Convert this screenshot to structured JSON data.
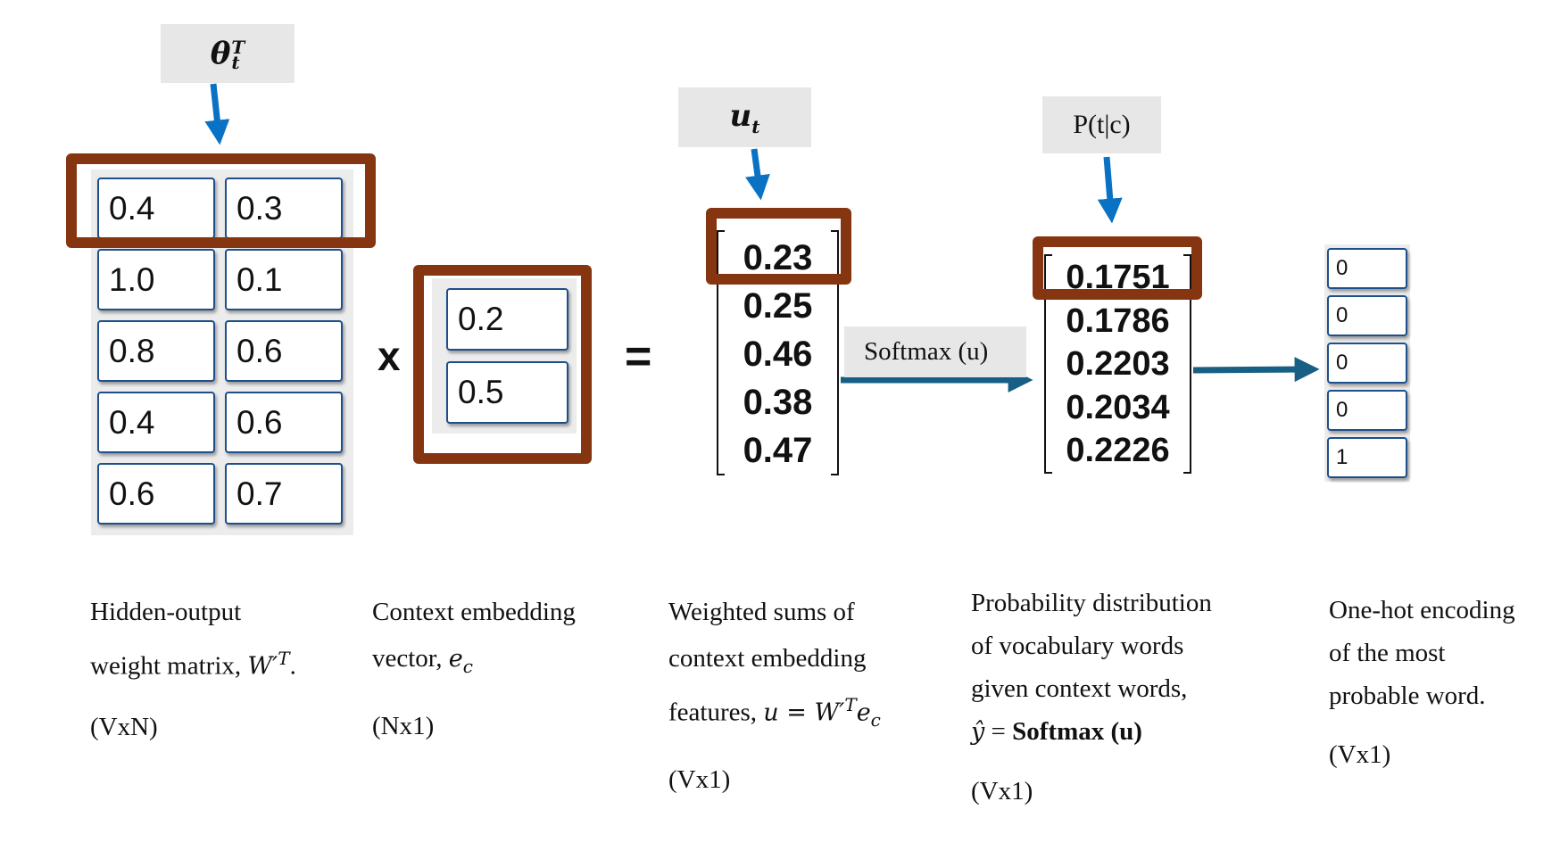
{
  "top_labels": {
    "theta": {
      "symbol": "θ",
      "sup": "T",
      "sub": "t"
    },
    "u": {
      "symbol": "u",
      "sub": "t"
    },
    "p": {
      "text": "P(t|c)"
    }
  },
  "weight_matrix": {
    "rows": [
      [
        "0.4",
        "0.3"
      ],
      [
        "1.0",
        "0.1"
      ],
      [
        "0.8",
        "0.6"
      ],
      [
        "0.4",
        "0.6"
      ],
      [
        "0.6",
        "0.7"
      ]
    ],
    "highlighted_row": 0
  },
  "operators": {
    "multiply": "x",
    "equals": "="
  },
  "context_vector": {
    "values": [
      "0.2",
      "0.5"
    ]
  },
  "u_vector": {
    "values": [
      "0.23",
      "0.25",
      "0.46",
      "0.38",
      "0.47"
    ],
    "highlighted_index": 0
  },
  "softmax_label": "Softmax (u)",
  "prob_vector": {
    "values": [
      "0.1751",
      "0.1786",
      "0.2203",
      "0.2034",
      "0.2226"
    ],
    "highlighted_index": 0
  },
  "one_hot": {
    "values": [
      "0",
      "0",
      "0",
      "0",
      "1"
    ]
  },
  "captions": {
    "matrix": {
      "line1": "Hidden-output",
      "line2_text": "weight matrix, ",
      "line2_math": "W′",
      "line2_sup": "T",
      "line2_end": ".",
      "dims": "(VxN)"
    },
    "context": {
      "line1": "Context embedding",
      "line2_text": "vector, ",
      "line2_math": "e",
      "line2_sub": "c",
      "dims": "(Nx1)"
    },
    "u": {
      "line1": "Weighted sums of",
      "line2": "context embedding",
      "line3_text": "features, ",
      "line3_math": "u = W′",
      "line3_sup": "T",
      "line3_math2": "e",
      "line3_sub": "c",
      "dims": "(Vx1)"
    },
    "prob": {
      "line1": "Probability distribution",
      "line2": "of vocabulary words",
      "line3": "given context words,",
      "line4_math": "ŷ",
      "line4_text": " = ",
      "line4_bold": "Softmax (u)",
      "dims": "(Vx1)"
    },
    "onehot": {
      "line1": "One-hot encoding",
      "line2": "of the most",
      "line3": "probable word.",
      "dims": "(Vx1)"
    }
  },
  "colors": {
    "highlight_border": "#853510",
    "pointer_arrow": "#0a72c4",
    "flow_arrow": "#175f85",
    "cell_border": "#1d4f8a",
    "label_bg": "#e7e7e7"
  }
}
